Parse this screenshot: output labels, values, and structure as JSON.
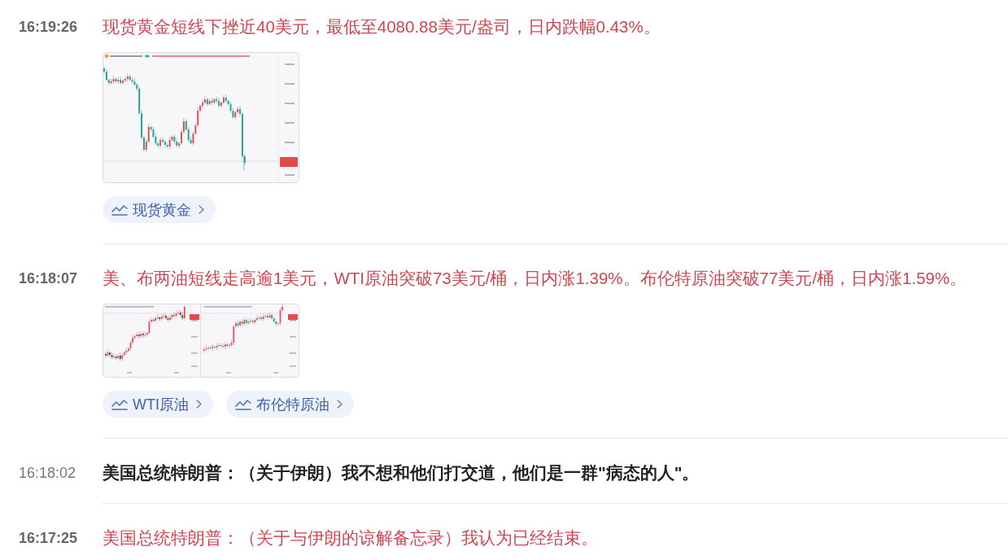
{
  "feed": [
    {
      "time": "16:19:26",
      "text": "现货黄金短线下挫近40美元，最低至4080.88美元/盎司，日内跌幅0.43%。",
      "highlighted": true,
      "thumbnail": {
        "kind": "single_chart"
      },
      "tags": [
        {
          "label": "现货黄金"
        }
      ]
    },
    {
      "time": "16:18:07",
      "text": "美、布两油短线走高逾1美元，WTI原油突破73美元/桶，日内涨1.39%。布伦特原油突破77美元/桶，日内涨1.59%。",
      "highlighted": true,
      "thumbnail": {
        "kind": "double_chart"
      },
      "tags": [
        {
          "label": "WTI原油"
        },
        {
          "label": "布伦特原油"
        }
      ]
    },
    {
      "time": "16:18:02",
      "text": "美国总统特朗普：（关于伊朗）我不想和他们打交道，他们是一群\"病态的人\"。",
      "highlighted": false
    },
    {
      "time": "16:17:25",
      "text": "美国总统特朗普：（关于与伊朗的谅解备忘录）我认为已经结束。",
      "highlighted": true
    }
  ]
}
